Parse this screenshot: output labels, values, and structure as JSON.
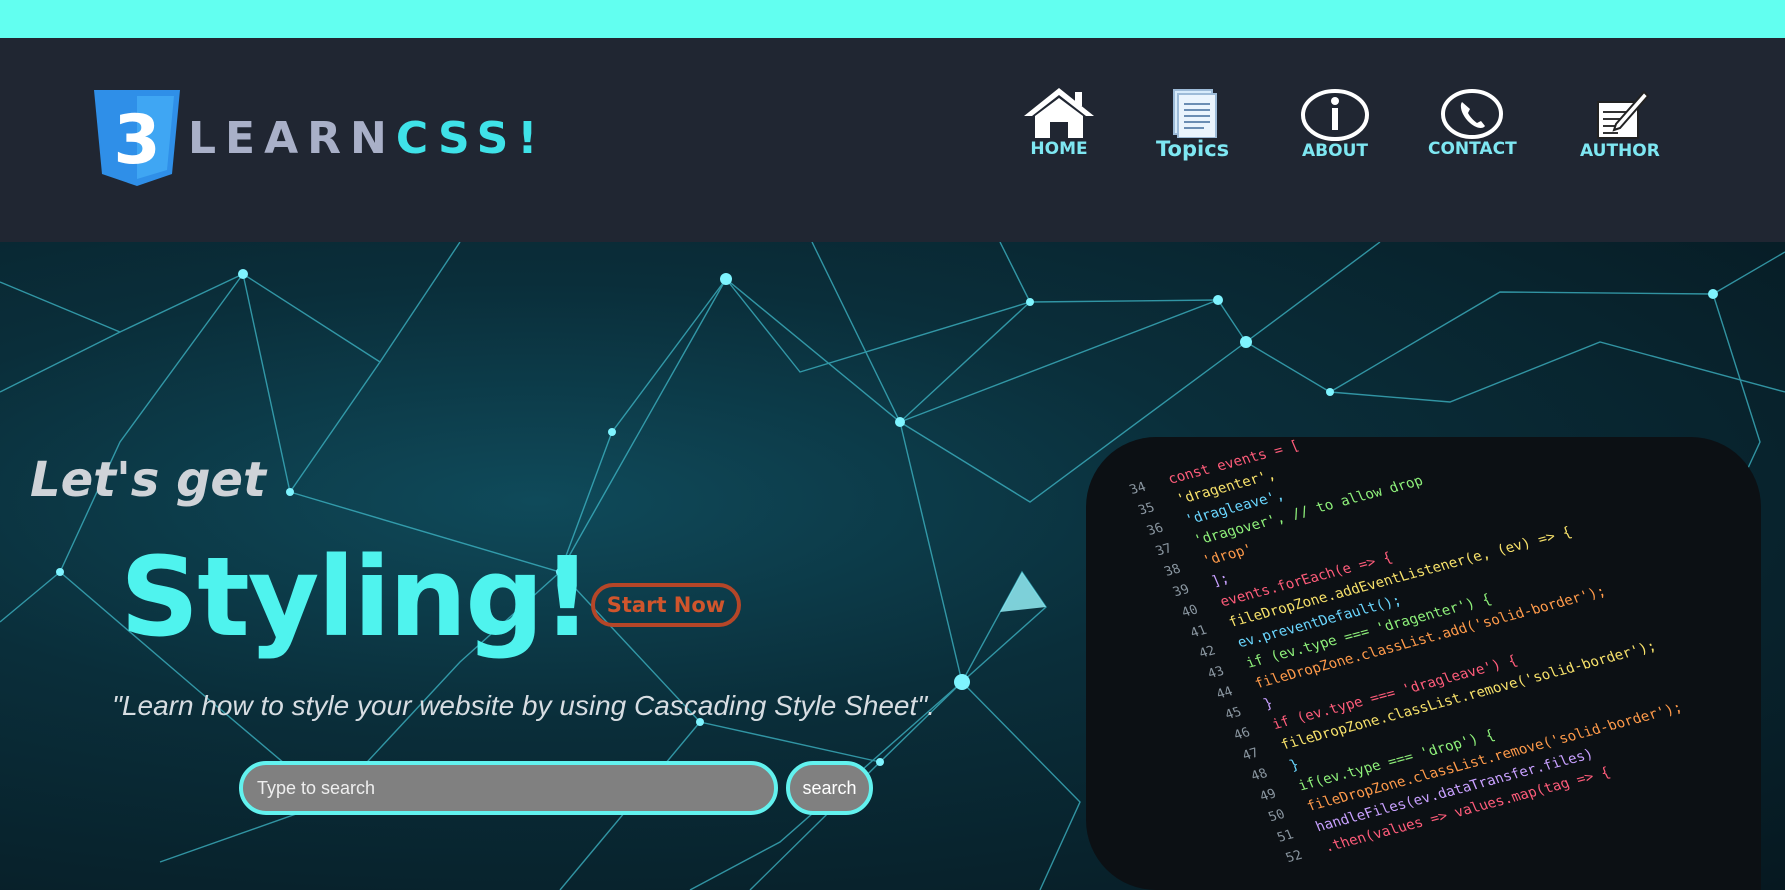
{
  "colors": {
    "top_bar": "#62fff0",
    "header_bg": "#202632",
    "accent": "#4ff3ee",
    "nav_text": "#7ee7f2",
    "start_now": "#d0552c"
  },
  "logo": {
    "learn": "LEARN",
    "css": "CSS!",
    "icon": "css3-shield-icon"
  },
  "nav": [
    {
      "label": "HOME",
      "icon": "home-icon"
    },
    {
      "label": "Topics",
      "icon": "document-icon"
    },
    {
      "label": "ABOUT",
      "icon": "info-icon"
    },
    {
      "label": "CONTACT",
      "icon": "phone-icon"
    },
    {
      "label": "AUTHOR",
      "icon": "write-icon"
    }
  ],
  "hero": {
    "lets_get": "Let's get",
    "styling": "Styling!",
    "start_now": "Start Now",
    "tagline": "\"Learn how to style your website by using Cascading Style Sheet\".",
    "search_placeholder": "Type to search",
    "search_button": "search"
  },
  "code_image": {
    "line_numbers": [
      "34",
      "35",
      "36",
      "37",
      "38",
      "39",
      "40",
      "41",
      "42",
      "43",
      "44",
      "45",
      "46",
      "47",
      "48",
      "49",
      "50",
      "51",
      "52"
    ],
    "lines": [
      "const events = [",
      "  'dragenter',",
      "  'dragleave',",
      "  'dragover', // to allow drop",
      "  'drop'",
      "];",
      "events.forEach(e => {",
      "  fileDropZone.addEventListener(e, (ev) => {",
      "    ev.preventDefault();",
      "    if (ev.type === 'dragenter') {",
      "      fileDropZone.classList.add('solid-border');",
      "    }",
      "    if (ev.type === 'dragleave') {",
      "      fileDropZone.classList.remove('solid-border');",
      "    }",
      "    if(ev.type === 'drop') {",
      "      fileDropZone.classList.remove('solid-border');",
      "      handleFiles(ev.dataTransfer.files)",
      "        .then(values => values.map(tag => {"
    ]
  }
}
